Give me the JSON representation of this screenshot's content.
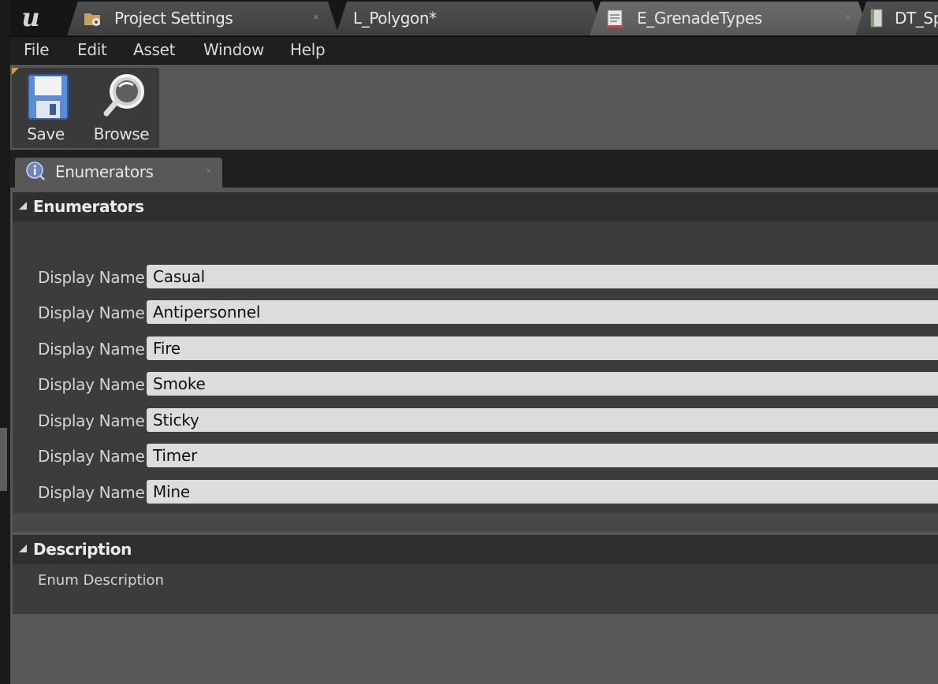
{
  "tabs": [
    {
      "label": "Project Settings",
      "icon": "settings-folder-icon",
      "close": "×"
    },
    {
      "label": "L_Polygon*",
      "icon": null,
      "close": null
    },
    {
      "label": "E_GrenadeTypes",
      "icon": "enum-document-icon",
      "close": "×",
      "active": true
    },
    {
      "label": "DT_Sp",
      "icon": "data-table-icon",
      "close": null
    }
  ],
  "menu": [
    "File",
    "Edit",
    "Asset",
    "Window",
    "Help"
  ],
  "toolbar": {
    "save_label": "Save",
    "browse_label": "Browse"
  },
  "panel_tab": {
    "label": "Enumerators",
    "close": "×",
    "icon": "info-icon"
  },
  "enumerators": {
    "title": "Enumerators",
    "row_label": "Display Name",
    "values": [
      "Casual",
      "Antipersonnel",
      "Fire",
      "Smoke",
      "Sticky",
      "Timer",
      "Mine"
    ]
  },
  "description": {
    "title": "Description",
    "label": "Enum Description"
  },
  "colors": {
    "accent": "#d8a21a",
    "background": "#575757",
    "field": "#dcdcdc"
  }
}
